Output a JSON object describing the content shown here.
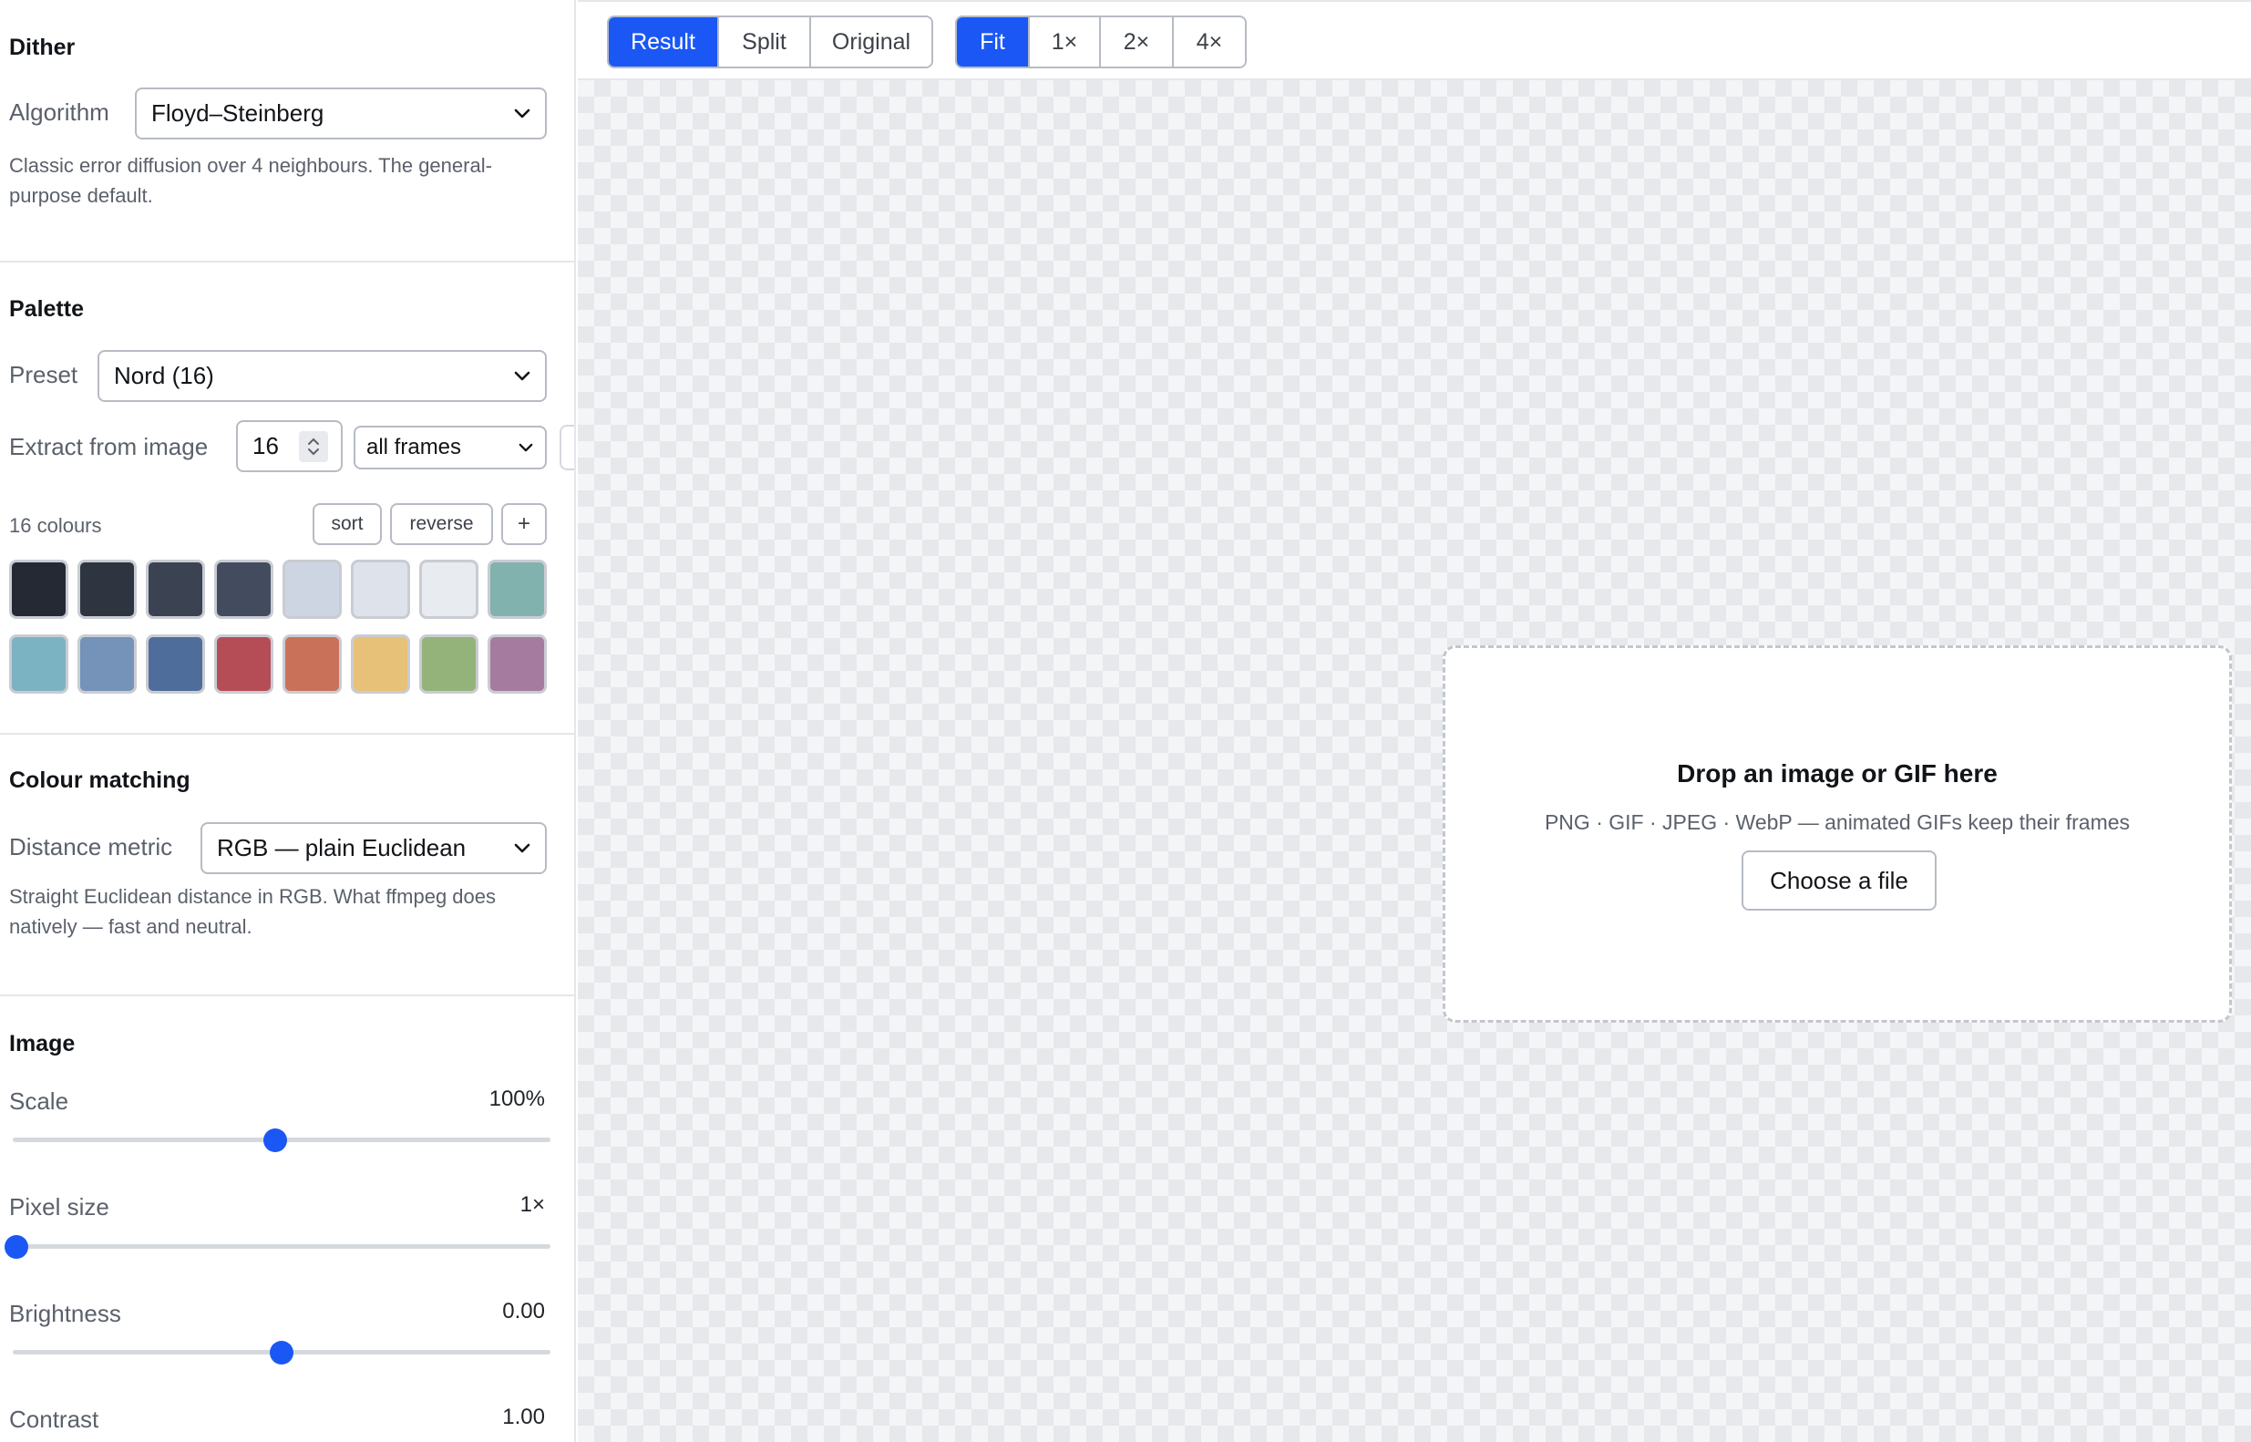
{
  "dither": {
    "heading": "Dither",
    "algorithm_label": "Algorithm",
    "algorithm_value": "Floyd–Steinberg",
    "description": "Classic error diffusion over 4 neighbours. The general-purpose default."
  },
  "palette": {
    "heading": "Palette",
    "preset_label": "Preset",
    "preset_value": "Nord (16)",
    "extract_label": "Extract from image",
    "extract_count": "16",
    "extract_frames": "all frames",
    "colour_count": "16 colours",
    "sort_label": "sort",
    "reverse_label": "reverse",
    "add_label": "+",
    "colors": [
      "#242933",
      "#2e3440",
      "#3b4252",
      "#434c5e",
      "#cdd5e2",
      "#dee3eb",
      "#e8ebf0",
      "#82b2ad",
      "#7bb3c3",
      "#7592b9",
      "#4f6d9b",
      "#b44d56",
      "#c97259",
      "#e6c177",
      "#94b37a",
      "#a57ba0"
    ]
  },
  "matching": {
    "heading": "Colour matching",
    "metric_label": "Distance metric",
    "metric_value": "RGB — plain Euclidean",
    "description": "Straight Euclidean distance in RGB. What ffmpeg does natively — fast and neutral."
  },
  "image": {
    "heading": "Image",
    "scale_label": "Scale",
    "scale_value": "100%",
    "scale_fraction": 0.488,
    "pixel_label": "Pixel size",
    "pixel_value": "1×",
    "pixel_fraction": 0.0,
    "brightness_label": "Brightness",
    "brightness_value": "0.00",
    "brightness_fraction": 0.5,
    "contrast_label": "Contrast",
    "contrast_value": "1.00"
  },
  "toolbar": {
    "view_modes": [
      "Result",
      "Split",
      "Original"
    ],
    "active_view": "Result",
    "zoom_modes": [
      "Fit",
      "1×",
      "2×",
      "4×"
    ],
    "active_zoom": "Fit"
  },
  "dropzone": {
    "title": "Drop an image or GIF here",
    "subtitle": "PNG · GIF · JPEG · WebP — animated GIFs keep their frames",
    "button_label": "Choose a file"
  },
  "colors": {
    "accent": "#1a57f5"
  }
}
